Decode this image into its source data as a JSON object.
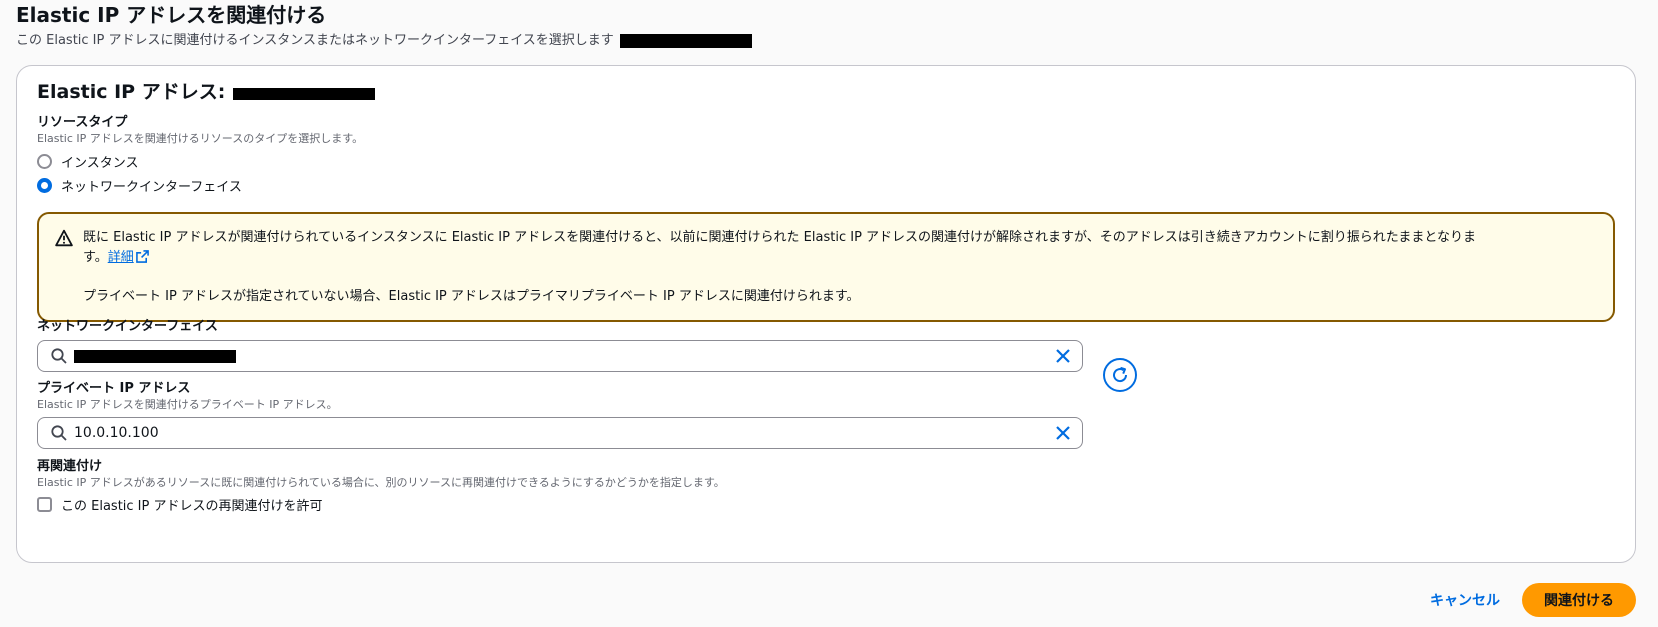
{
  "header": {
    "title": "Elastic IP アドレスを関連付ける",
    "description": "この Elastic IP アドレスに関連付けるインスタンスまたはネットワークインターフェイスを選択します"
  },
  "card": {
    "title": "Elastic IP アドレス:"
  },
  "resource_type": {
    "label": "リソースタイプ",
    "description": "Elastic IP アドレスを関連付けるリソースのタイプを選択します。",
    "options": [
      {
        "label": "インスタンス",
        "selected": false
      },
      {
        "label": "ネットワークインターフェイス",
        "selected": true
      }
    ]
  },
  "alert": {
    "text1": "既に Elastic IP アドレスが関連付けられているインスタンスに Elastic IP アドレスを関連付けると、以前に関連付けられた Elastic IP アドレスの関連付けが解除されますが、そのアドレスは引き続きアカウントに割り振られたままとなりま",
    "text1_tail": "す。",
    "link": "詳細",
    "text2": "プライベート IP アドレスが指定されていない場合、Elastic IP アドレスはプライマリプライベート IP アドレスに関連付けられます。"
  },
  "network_interface": {
    "label": "ネットワークインターフェイス"
  },
  "private_ip": {
    "label": "プライベート IP アドレス",
    "description": "Elastic IP アドレスを関連付けるプライベート IP アドレス。",
    "value": "10.0.10.100"
  },
  "reassociation": {
    "label": "再関連付け",
    "description": "Elastic IP アドレスがあるリソースに既に関連付けられている場合に、別のリソースに再関連付けできるようにするかどうかを指定します。",
    "checkbox_label": "この Elastic IP アドレスの再関連付けを許可",
    "checked": false
  },
  "footer": {
    "cancel_label": "キャンセル",
    "submit_label": "関連付ける"
  },
  "colors": {
    "accent": "#006ce0",
    "primary_button": "#ff9900",
    "warning_border": "#855900",
    "warning_bg": "#fffce9"
  }
}
